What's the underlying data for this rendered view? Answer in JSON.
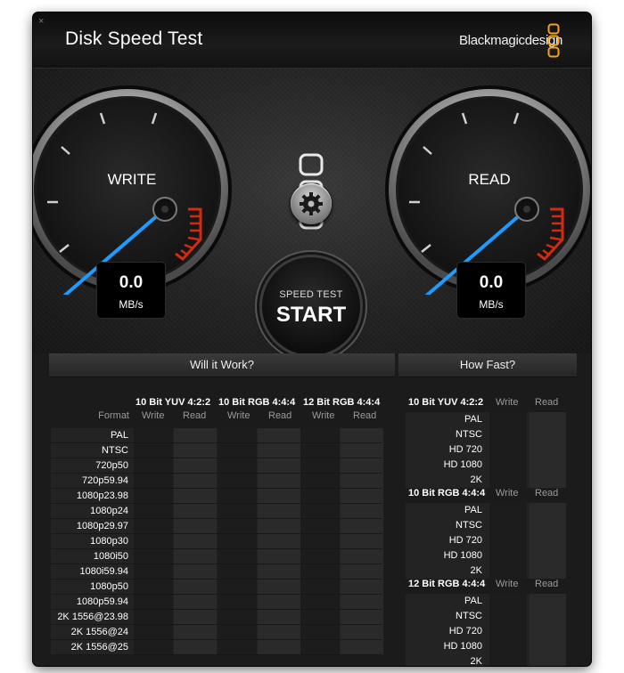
{
  "window": {
    "close_glyph": "×",
    "title": "Disk Speed Test",
    "brand": "Blackmagicdesign"
  },
  "gauges": {
    "write": {
      "label": "WRITE",
      "value": "0.0",
      "unit": "MB/s"
    },
    "read": {
      "label": "READ",
      "value": "0.0",
      "unit": "MB/s"
    }
  },
  "start_button": {
    "line1": "SPEED TEST",
    "line2": "START"
  },
  "icons": [
    "close-icon",
    "blackmagic-logo-icon",
    "blackmagic-large-logo-icon",
    "gear-icon"
  ],
  "colors": {
    "needle": "#1e9bff",
    "redzone": "#d42a10",
    "logo_orange": "#f5a21c"
  },
  "will_it_work": {
    "title": "Will it Work?",
    "format_header": "Format",
    "groups": [
      {
        "name": "10 Bit YUV 4:2:2",
        "write": "Write",
        "read": "Read"
      },
      {
        "name": "10 Bit RGB 4:4:4",
        "write": "Write",
        "read": "Read"
      },
      {
        "name": "12 Bit RGB 4:4:4",
        "write": "Write",
        "read": "Read"
      }
    ],
    "formats": [
      "PAL",
      "NTSC",
      "720p50",
      "720p59.94",
      "1080p23.98",
      "1080p24",
      "1080p29.97",
      "1080p30",
      "1080i50",
      "1080i59.94",
      "1080p50",
      "1080p59.94",
      "2K 1556@23.98",
      "2K 1556@24",
      "2K 1556@25"
    ]
  },
  "how_fast": {
    "title": "How Fast?",
    "groups": [
      {
        "name": "10 Bit YUV 4:2:2",
        "write": "Write",
        "read": "Read",
        "rows": [
          "PAL",
          "NTSC",
          "HD 720",
          "HD 1080",
          "2K"
        ]
      },
      {
        "name": "10 Bit RGB 4:4:4",
        "write": "Write",
        "read": "Read",
        "rows": [
          "PAL",
          "NTSC",
          "HD 720",
          "HD 1080",
          "2K"
        ]
      },
      {
        "name": "12 Bit RGB 4:4:4",
        "write": "Write",
        "read": "Read",
        "rows": [
          "PAL",
          "NTSC",
          "HD 720",
          "HD 1080",
          "2K"
        ]
      }
    ]
  }
}
